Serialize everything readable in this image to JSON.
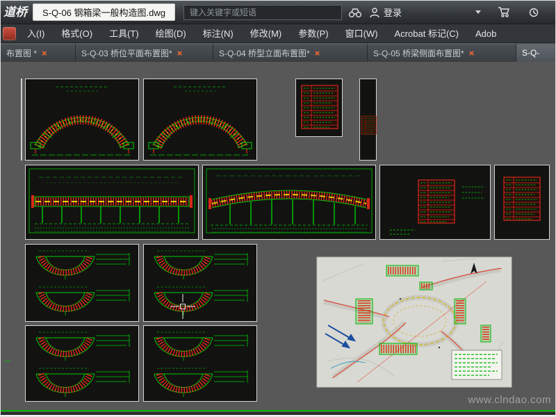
{
  "window": {
    "logo_text": "道桥",
    "title": "S-Q-06 钢箱梁一般构造图.dwg",
    "search_placeholder": "键入关键字或短语",
    "sign_in_label": "登录"
  },
  "menu": {
    "items": [
      "入(I)",
      "格式(O)",
      "工具(T)",
      "绘图(D)",
      "标注(N)",
      "修改(M)",
      "参数(P)",
      "窗口(W)",
      "Acrobat 标记(C)",
      "Adob"
    ]
  },
  "tabs": {
    "close_glyph": "×",
    "items": [
      {
        "label": "布置图 *"
      },
      {
        "label": "S-Q-03 桥位平面布置图*"
      },
      {
        "label": "S-Q-04 桥型立面布置图*"
      },
      {
        "label": "S-Q-05 桥梁侧面布置图*"
      },
      {
        "label": "S-Q-"
      }
    ]
  },
  "canvas": {
    "watermark": "www.clndao.com"
  },
  "colors": {
    "cad_green": "#00cc00",
    "cad_red": "#ff2d1a",
    "cad_yellow": "#f2e400",
    "canvas_bg": "#585858",
    "close_x": "#ff6a2e"
  }
}
